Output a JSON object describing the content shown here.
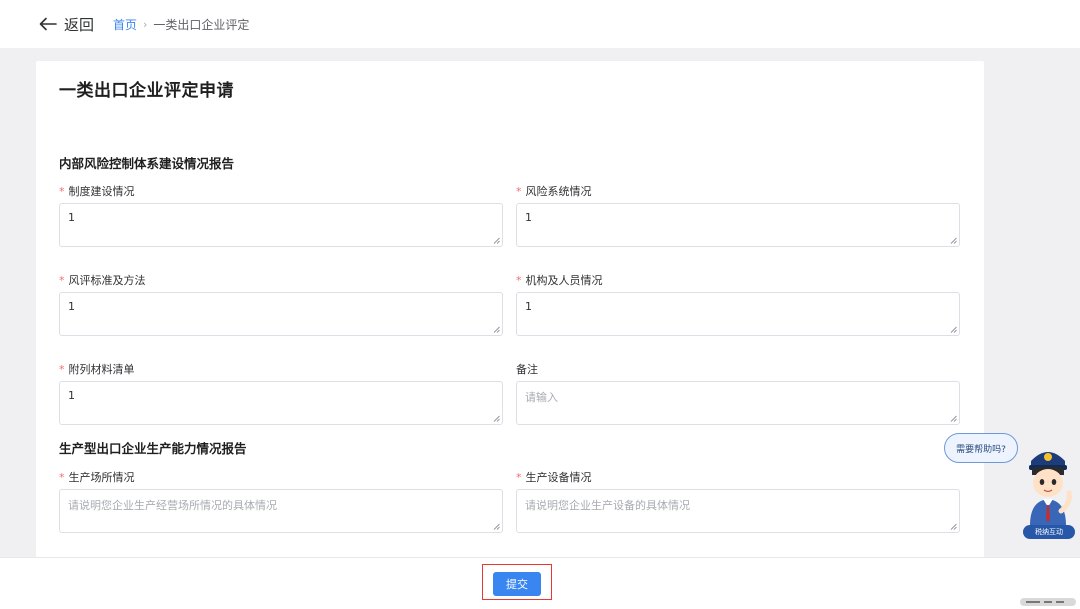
{
  "topbar": {
    "back_label": "返回",
    "breadcrumb": {
      "home": "首页",
      "separator": "›",
      "current": "一类出口企业评定"
    }
  },
  "form": {
    "title": "一类出口企业评定申请",
    "section1": {
      "title": "内部风险控制体系建设情况报告",
      "fields": [
        {
          "label": "制度建设情况",
          "required": "*",
          "value": "1"
        },
        {
          "label": "风险系统情况",
          "required": "*",
          "value": "1"
        },
        {
          "label": "风评标准及方法",
          "required": "*",
          "value": "1"
        },
        {
          "label": "机构及人员情况",
          "required": "*",
          "value": "1"
        },
        {
          "label": "附列材料清单",
          "required": "*",
          "value": "1"
        },
        {
          "label": "备注",
          "required": "",
          "placeholder": "请输入"
        }
      ]
    },
    "section2": {
      "title": "生产型出口企业生产能力情况报告",
      "fields": [
        {
          "label": "生产场所情况",
          "required": "*",
          "placeholder": "请说明您企业生产经营场所情况的具体情况"
        },
        {
          "label": "生产设备情况",
          "required": "*",
          "placeholder": "请说明您企业生产设备的具体情况"
        }
      ]
    }
  },
  "footer": {
    "submit_label": "提交"
  },
  "assistant": {
    "bubble_text": "需要帮助吗?",
    "tag_text": "税纳互动"
  },
  "colors": {
    "primary": "#3a86f0",
    "required": "#f56c6c",
    "highlight": "#e53935",
    "assistant_tag": "#2757a8"
  }
}
